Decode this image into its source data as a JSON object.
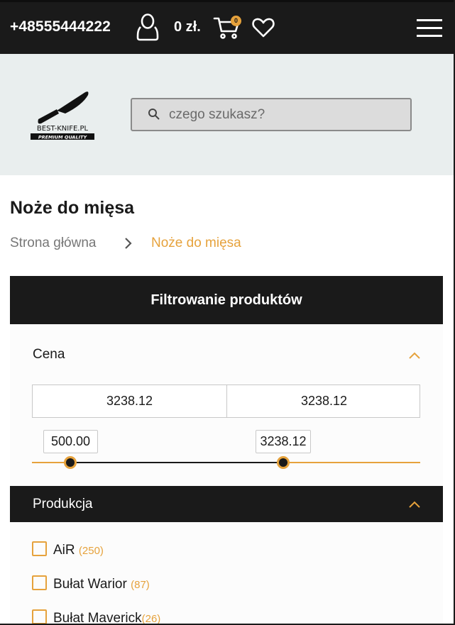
{
  "topbar": {
    "phone": "+48555444222",
    "price": "0 zł.",
    "cart_count": "0"
  },
  "header": {
    "search_placeholder": "czego szukasz?"
  },
  "page": {
    "title": "Noże do mięsa"
  },
  "breadcrumb": {
    "home": "Strona główna",
    "current": "Noże do mięsa"
  },
  "filters": {
    "heading": "Filtrowanie produktów",
    "price": {
      "label": "Cena",
      "input_min": "3238.12",
      "input_max": "3238.12",
      "slider_min_label": "500.00",
      "slider_max_label": "3238.12"
    },
    "production": {
      "label": "Produkcja",
      "items": [
        {
          "name": "AiR",
          "count": "(250)"
        },
        {
          "name": "Bułat Warior",
          "count": "(87)"
        },
        {
          "name": "Bułat Maverick",
          "count": "(26)"
        }
      ]
    }
  },
  "colors": {
    "accent": "#e6a23c",
    "dark": "#1a1a1a",
    "header_bg": "#e9eeee"
  }
}
